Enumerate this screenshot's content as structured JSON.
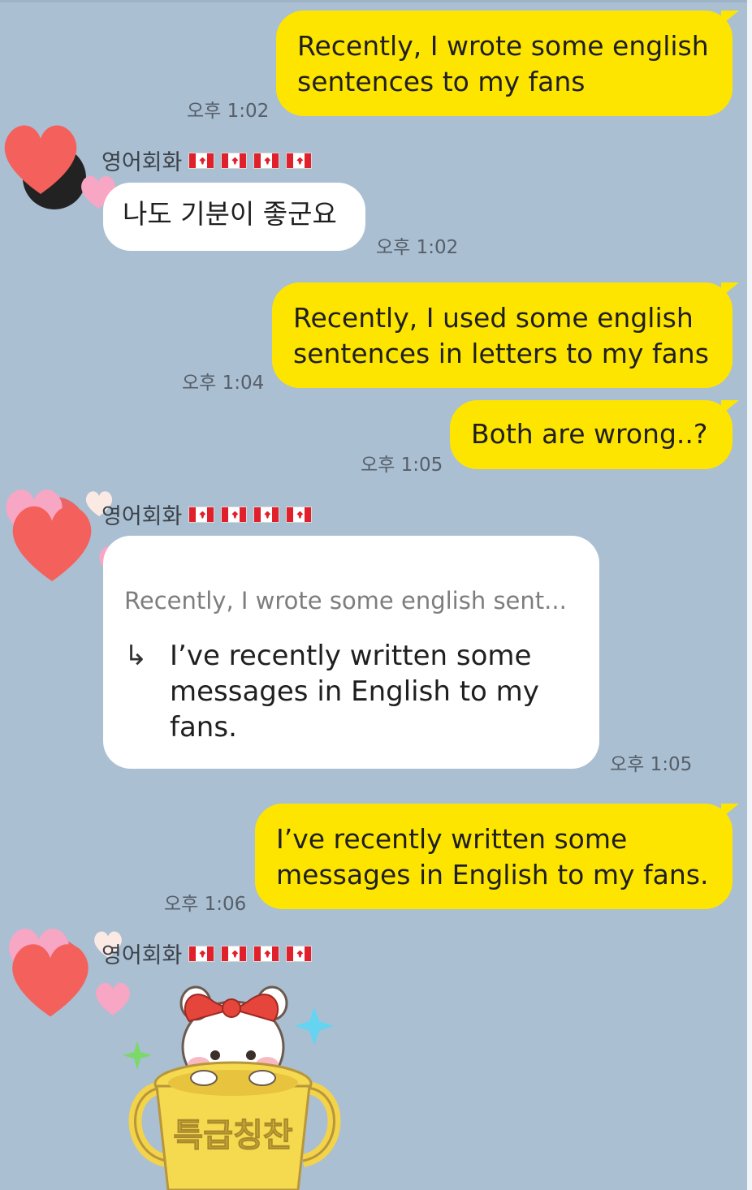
{
  "messages": {
    "m1": {
      "text": "Recently, I wrote some english sentences to my fans",
      "time": "오후 1:02"
    },
    "m2": {
      "sender": "영어회화",
      "text": "나도 기분이 좋군요",
      "time": "오후 1:02"
    },
    "m3": {
      "text": "Recently, I used some english sentences in letters to my fans",
      "time": "오후 1:04"
    },
    "m4": {
      "text": "Both are wrong..?",
      "time": "오후 1:05"
    },
    "m5": {
      "sender": "영어회화",
      "quote": "Recently, I wrote some english sent...",
      "arrow": "↳",
      "reply": "I’ve recently written some messages in English to my fans.",
      "time": "오후 1:05"
    },
    "m6": {
      "text": "I’ve recently written some messages in English to my fans.",
      "time": "오후 1:06"
    },
    "m7": {
      "sender": "영어회화",
      "sticker_text": "특급칭찬"
    }
  },
  "colors": {
    "background": "#aabfd2",
    "my_bubble": "#fee500",
    "their_bubble": "#ffffff"
  },
  "icons": [
    "heart-icon",
    "canada-flag-icon",
    "reply-arrow-icon",
    "sparkle-icon"
  ]
}
